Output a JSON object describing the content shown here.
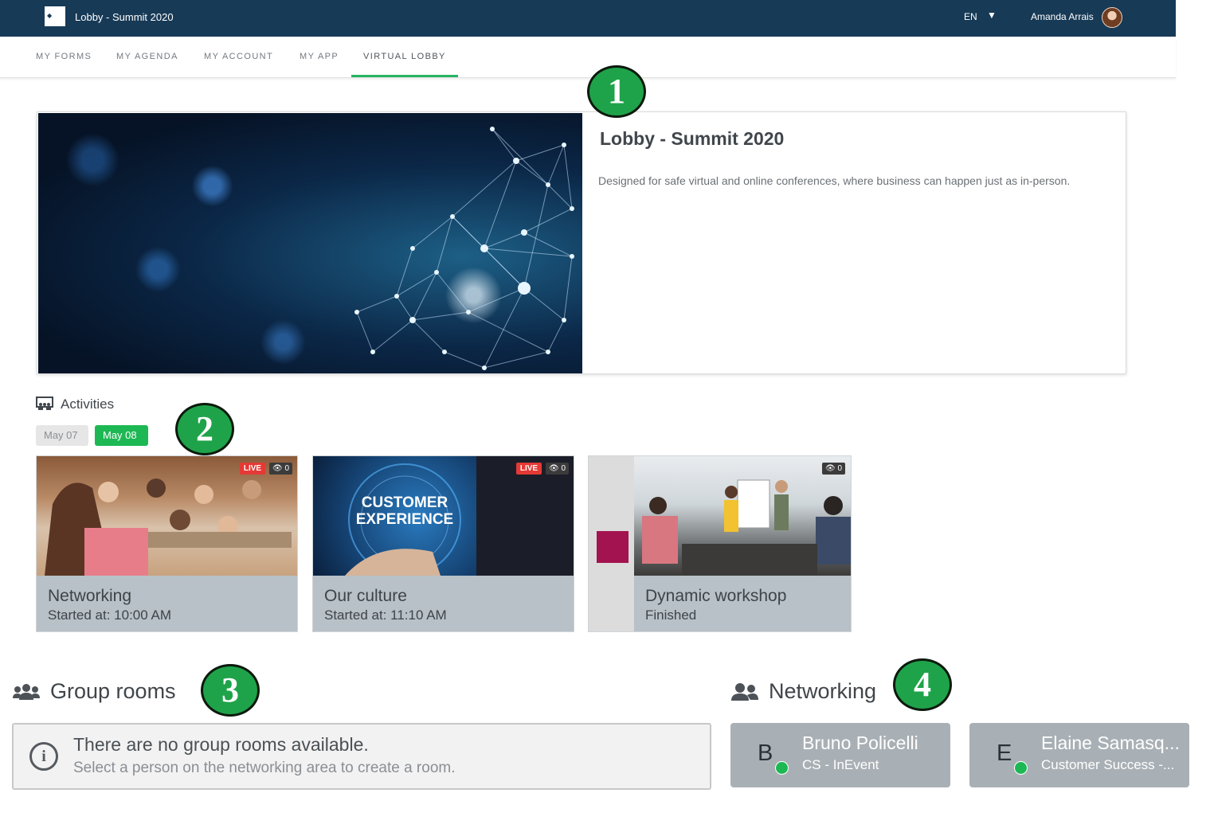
{
  "topbar": {
    "title": "Lobby - Summit 2020",
    "language": "EN",
    "user_name": "Amanda Arrais"
  },
  "nav": {
    "tabs": [
      {
        "label": "MY FORMS"
      },
      {
        "label": "MY AGENDA"
      },
      {
        "label": "MY ACCOUNT"
      },
      {
        "label": "MY APP"
      },
      {
        "label": "VIRTUAL LOBBY",
        "active": true
      }
    ]
  },
  "markers": [
    "1",
    "2",
    "3",
    "4"
  ],
  "hero": {
    "title": "Lobby - Summit 2020",
    "description": "Designed for safe virtual and online conferences, where business can happen just as in-person."
  },
  "activities": {
    "label": "Activities",
    "dates": [
      {
        "label": "May 07",
        "active": false
      },
      {
        "label": "May 08",
        "active": true
      }
    ],
    "cards": [
      {
        "title": "Networking",
        "subtitle": "Started at: 10:00 AM",
        "live": "LIVE",
        "views": "0"
      },
      {
        "title": "Our culture",
        "subtitle": "Started at: 11:10 AM",
        "live": "LIVE",
        "views": "0",
        "thumb_text_1": "CUSTOMER",
        "thumb_text_2": "EXPERIENCE"
      },
      {
        "title": "Dynamic workshop",
        "subtitle": "Finished",
        "views": "0"
      }
    ]
  },
  "group_rooms": {
    "title": "Group rooms",
    "empty_title": "There are no group rooms available.",
    "empty_subtitle": "Select a person on the networking area to create a room."
  },
  "networking": {
    "title": "Networking",
    "people": [
      {
        "initial": "B",
        "name": "Bruno Policelli",
        "role": "CS - InEvent"
      },
      {
        "initial": "E",
        "name": "Elaine Samasq...",
        "role": "Customer Success -..."
      }
    ]
  },
  "colors": {
    "topbar": "#173a56",
    "accent_green": "#1db853",
    "live_red": "#e53935"
  }
}
